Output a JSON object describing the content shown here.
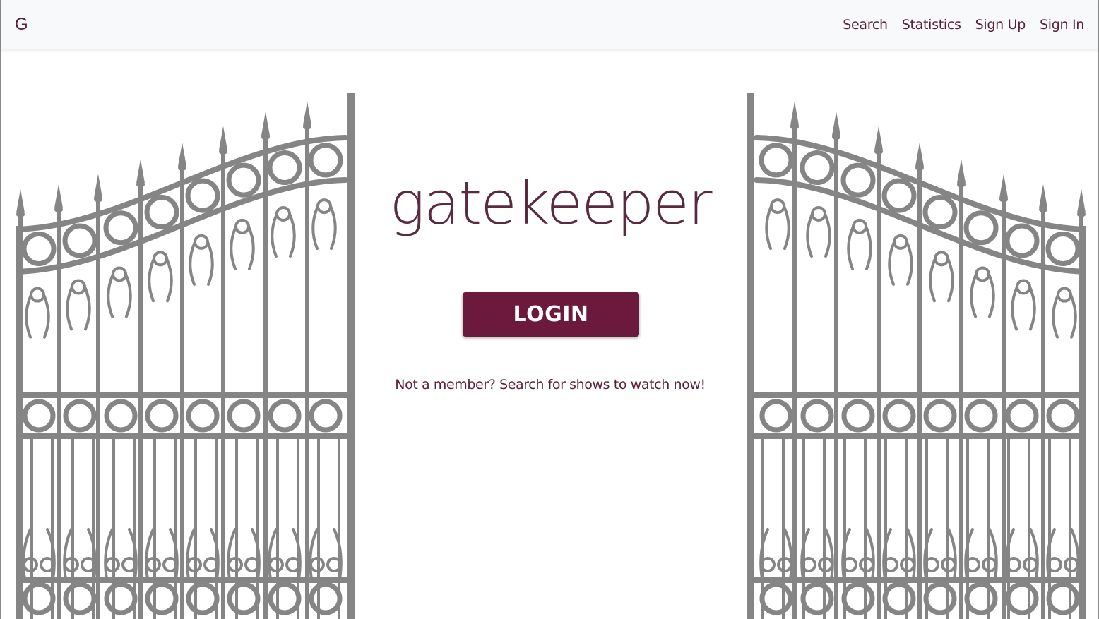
{
  "navbar": {
    "brand": "G",
    "links": [
      "Search",
      "Statistics",
      "Sign Up",
      "Sign In"
    ]
  },
  "hero": {
    "title": "gatekeeper",
    "login_label": "LOGIN",
    "member_link": "Not a member? Search for shows to watch now!"
  },
  "colors": {
    "brand": "#6b1a3e",
    "text": "#5a1f3a",
    "gate": "#858585",
    "navbar_bg": "#f8f9fa"
  },
  "icons": [
    "left-gate-illustration",
    "right-gate-illustration"
  ]
}
